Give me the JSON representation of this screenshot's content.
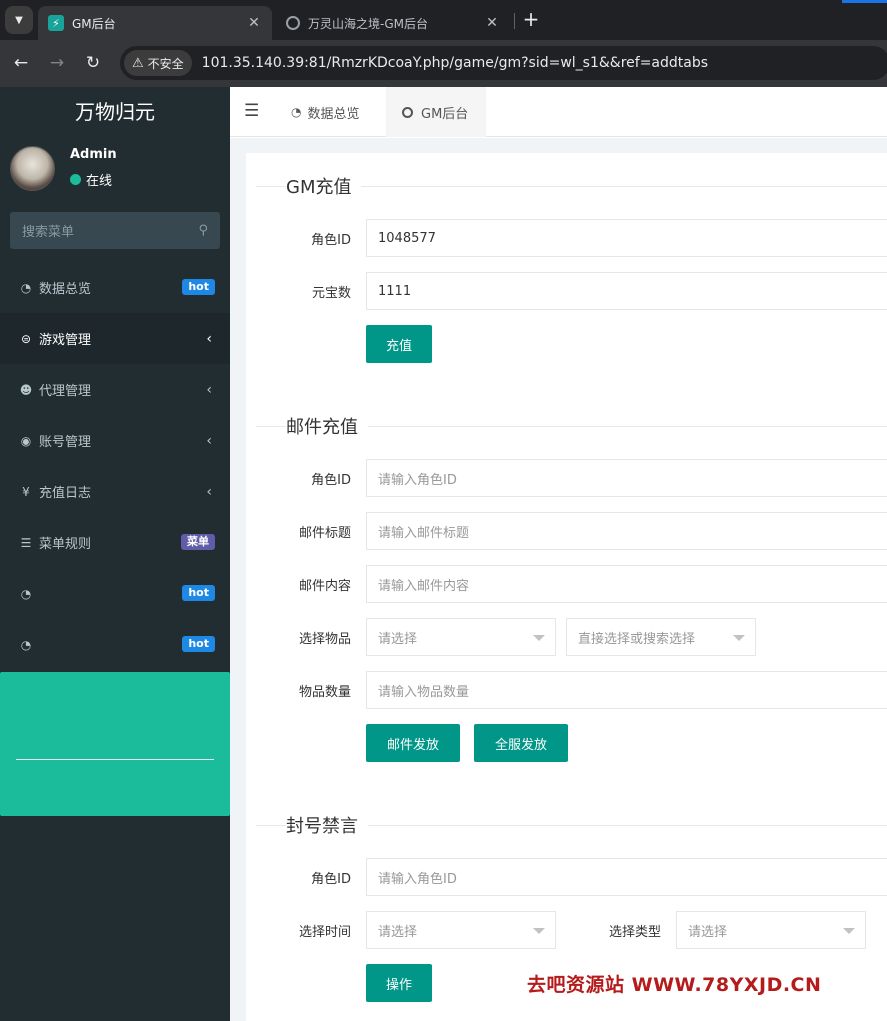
{
  "browser": {
    "tabs": [
      {
        "title": "GM后台",
        "active": true
      },
      {
        "title": "万灵山海之境-GM后台",
        "active": false
      }
    ],
    "security_label": "不安全",
    "url": "101.35.140.39:81/RmzrKDcoaY.php/game/gm?sid=wl_s1&&ref=addtabs"
  },
  "sidebar": {
    "brand": "万物归元",
    "user": {
      "name": "Admin",
      "status": "在线"
    },
    "search_placeholder": "搜索菜单",
    "items": [
      {
        "label": "数据总览",
        "icon": "dashboard-icon",
        "badge": "hot"
      },
      {
        "label": "游戏管理",
        "icon": "gamepad-icon",
        "active": true
      },
      {
        "label": "代理管理",
        "icon": "users-icon"
      },
      {
        "label": "账号管理",
        "icon": "user-circle-icon"
      },
      {
        "label": "充值日志",
        "icon": "yen-icon"
      },
      {
        "label": "菜单规则",
        "icon": "bars-icon",
        "badge": "菜单"
      },
      {
        "label": "",
        "icon": "dashboard-icon",
        "badge": "hot"
      },
      {
        "label": "",
        "icon": "dashboard-icon",
        "badge": "hot"
      }
    ]
  },
  "header": {
    "tabs": [
      {
        "label": "数据总览"
      },
      {
        "label": "GM后台"
      }
    ]
  },
  "gm_recharge": {
    "title": "GM充值",
    "role_id_label": "角色ID",
    "role_id_value": "1048577",
    "ingot_label": "元宝数",
    "ingot_value": "1111",
    "submit_label": "充值"
  },
  "mail_recharge": {
    "title": "邮件充值",
    "role_id_label": "角色ID",
    "role_id_placeholder": "请输入角色ID",
    "mail_title_label": "邮件标题",
    "mail_title_placeholder": "请输入邮件标题",
    "mail_content_label": "邮件内容",
    "mail_content_placeholder": "请输入邮件内容",
    "item_label": "选择物品",
    "item_select_placeholder": "请选择",
    "item_search_placeholder": "直接选择或搜索选择",
    "quantity_label": "物品数量",
    "quantity_placeholder": "请输入物品数量",
    "send_label": "邮件发放",
    "send_all_label": "全服发放"
  },
  "ban": {
    "title": "封号禁言",
    "role_id_label": "角色ID",
    "role_id_placeholder": "请输入角色ID",
    "time_label": "选择时间",
    "time_placeholder": "请选择",
    "type_label": "选择类型",
    "type_placeholder": "请选择",
    "submit_label": "操作"
  },
  "watermark": "去吧资源站 WWW.78YXJD.CN",
  "colors": {
    "sidebar_bg": "#222d32",
    "accent_teal": "#009688",
    "panel_teal": "#1abc9c",
    "badge_blue": "#1e88e5",
    "badge_purple": "#605ca8",
    "watermark_red": "#b51b1b"
  }
}
